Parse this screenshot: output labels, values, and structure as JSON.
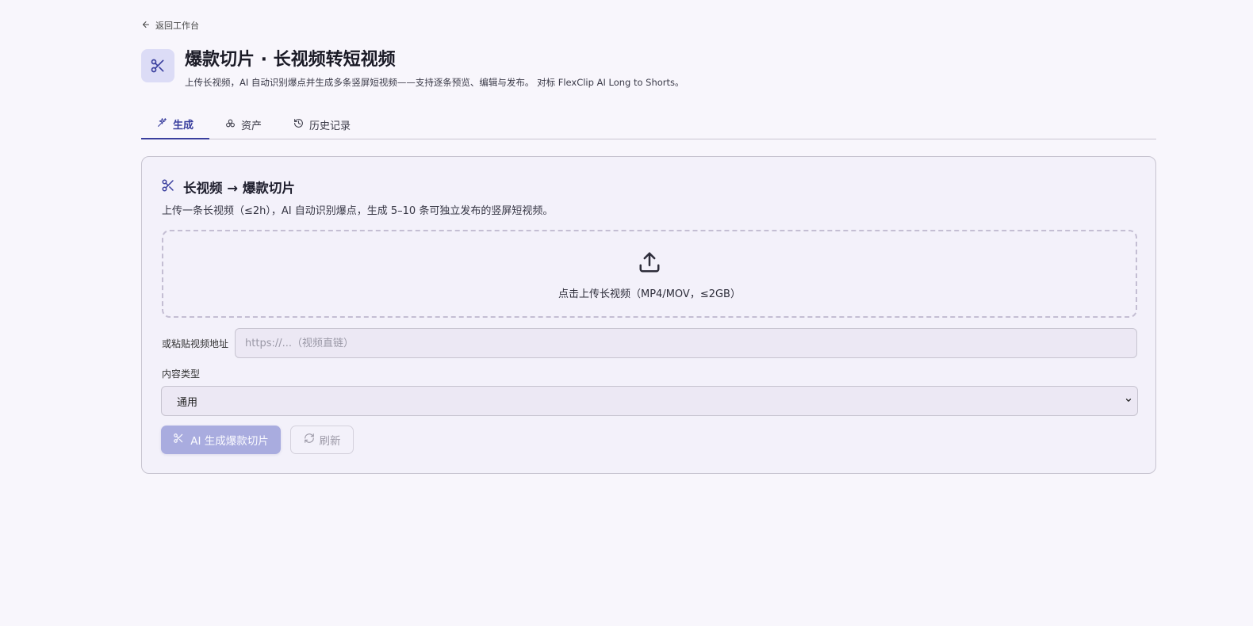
{
  "nav": {
    "back_label": "返回工作台"
  },
  "header": {
    "title": "爆款切片 · 长视频转短视频",
    "subtitle": "上传长视频，AI 自动识别爆点并生成多条竖屏短视频——支持逐条预览、编辑与发布。 对标 FlexClip AI Long to Shorts。"
  },
  "tabs": [
    {
      "label": "生成",
      "icon": "sparkles-icon",
      "active": true
    },
    {
      "label": "资产",
      "icon": "assets-icon",
      "active": false
    },
    {
      "label": "历史记录",
      "icon": "history-icon",
      "active": false
    }
  ],
  "card": {
    "title": "长视频 → 爆款切片",
    "description": "上传一条长视频（≤2h），AI 自动识别爆点，生成 5–10 条可独立发布的竖屏短视频。",
    "upload_text": "点击上传长视频（MP4/MOV，≤2GB）",
    "url_label": "或粘贴视频地址",
    "url_placeholder": "https://...（视频直链）",
    "url_value": "",
    "type_label": "内容类型",
    "type_selected": "通用",
    "primary_button": "AI 生成爆款切片",
    "refresh_button": "刷新"
  },
  "colors": {
    "accent": "#3a3f9e",
    "primary_button_bg": "#a9acdf",
    "page_bg": "#f8f6fc",
    "card_bg": "#f3f1fa"
  }
}
